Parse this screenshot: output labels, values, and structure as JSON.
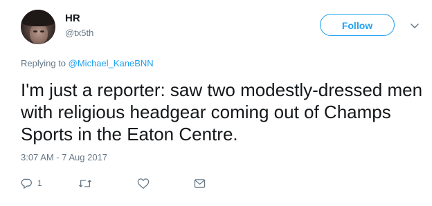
{
  "author": {
    "name": "HR",
    "handle": "@tx5th"
  },
  "follow_button": {
    "label": "Follow"
  },
  "reply_context": {
    "prefix": "Replying to ",
    "mention": "@Michael_KaneBNN"
  },
  "tweet": {
    "text": "I'm just a reporter: saw two modestly-dressed men with religious headgear coming out of Champs Sports in the Eaton Centre.",
    "timestamp": "3:07 AM - 7 Aug 2017"
  },
  "actions": {
    "reply_count": "1",
    "icons": [
      "reply-icon",
      "retweet-icon",
      "like-icon",
      "direct-message-icon"
    ]
  },
  "colors": {
    "accent": "#1da1f2",
    "secondary_text": "#657786",
    "primary_text": "#14171a"
  }
}
